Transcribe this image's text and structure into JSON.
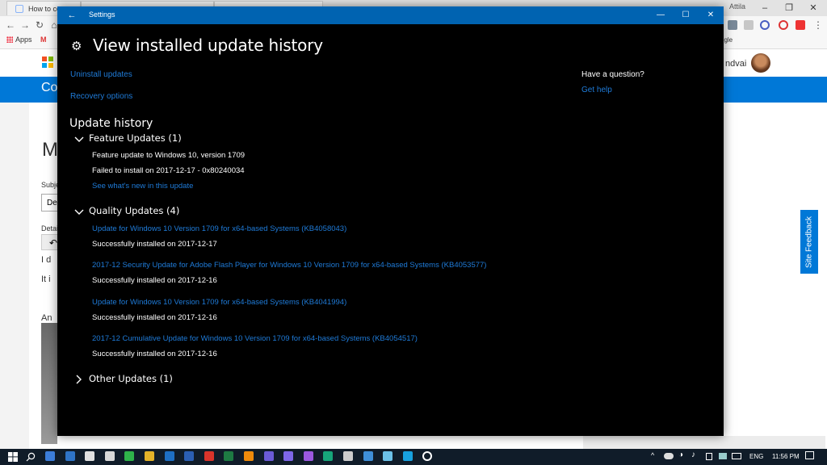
{
  "browser": {
    "tab1_label": "How to cop",
    "user_short": "Attila",
    "bookmarks": {
      "apps_label": "Apps"
    },
    "google_label": "ogle",
    "username": "ndvai"
  },
  "background_page": {
    "band_text": "Co",
    "big_letter": "M",
    "subject_label": "Subje",
    "subject_value": "De",
    "details_label": "Detai",
    "body_line1": "I d",
    "body_line2": "It i",
    "body_line3": "An",
    "site_feedback": "Site Feedback"
  },
  "settings": {
    "window_title": "Settings",
    "page_title": "View installed update history",
    "links": {
      "uninstall": "Uninstall updates",
      "recovery": "Recovery options"
    },
    "help": {
      "question": "Have a question?",
      "get_help": "Get help"
    },
    "history_heading": "Update history",
    "feature": {
      "label": "Feature Updates (1)",
      "title": "Feature update to Windows 10, version 1709",
      "status": "Failed to install on 2017-12-17 - 0x80240034",
      "link": "See what's new in this update"
    },
    "quality": {
      "label": "Quality Updates (4)",
      "items": [
        {
          "title": "Update for Windows 10 Version 1709 for x64-based Systems (KB4058043)",
          "status": "Successfully installed on 2017-12-17"
        },
        {
          "title": "2017-12 Security Update for Adobe Flash Player for Windows 10 Version 1709 for x64-based Systems (KB4053577)",
          "status": "Successfully installed on 2017-12-16"
        },
        {
          "title": "Update for Windows 10 Version 1709 for x64-based Systems (KB4041994)",
          "status": "Successfully installed on 2017-12-16"
        },
        {
          "title": "2017-12 Cumulative Update for Windows 10 Version 1709 for x64-based Systems (KB4054517)",
          "status": "Successfully installed on 2017-12-16"
        }
      ]
    },
    "other": {
      "label": "Other Updates (1)"
    }
  },
  "taskbar": {
    "language": "ENG",
    "clock": "11:56 PM",
    "apps": [
      {
        "icon": "edge-like-icon",
        "color": "#3c7dd9"
      },
      {
        "icon": "mail-icon",
        "color": "#2f74c7"
      },
      {
        "icon": "file-icon",
        "color": "#e0e0e0"
      },
      {
        "icon": "calculator-icon",
        "color": "#d8d8d8"
      },
      {
        "icon": "green-app-icon",
        "color": "#2fb34a"
      },
      {
        "icon": "chrome-icon",
        "color": "#e3b229"
      },
      {
        "icon": "outlook-icon",
        "color": "#1e6fc4"
      },
      {
        "icon": "word-icon",
        "color": "#2b5fb3"
      },
      {
        "icon": "acrobat-icon",
        "color": "#d9342b"
      },
      {
        "icon": "excel-icon",
        "color": "#1e7a43"
      },
      {
        "icon": "illustrator-icon",
        "color": "#ee8a0b"
      },
      {
        "icon": "premiere-icon",
        "color": "#6b5bd6"
      },
      {
        "icon": "after-effects-icon",
        "color": "#7e67e8"
      },
      {
        "icon": "premiere-alt-icon",
        "color": "#9b59e0"
      },
      {
        "icon": "animate-icon",
        "color": "#17a57a"
      },
      {
        "icon": "media-icon",
        "color": "#cccccc"
      },
      {
        "icon": "vscode-icon",
        "color": "#3f8fd8"
      },
      {
        "icon": "paint-icon",
        "color": "#6cc1e8"
      },
      {
        "icon": "skype-icon",
        "color": "#18a2e0"
      },
      {
        "icon": "settings-icon",
        "color": "#ffffff"
      }
    ]
  }
}
